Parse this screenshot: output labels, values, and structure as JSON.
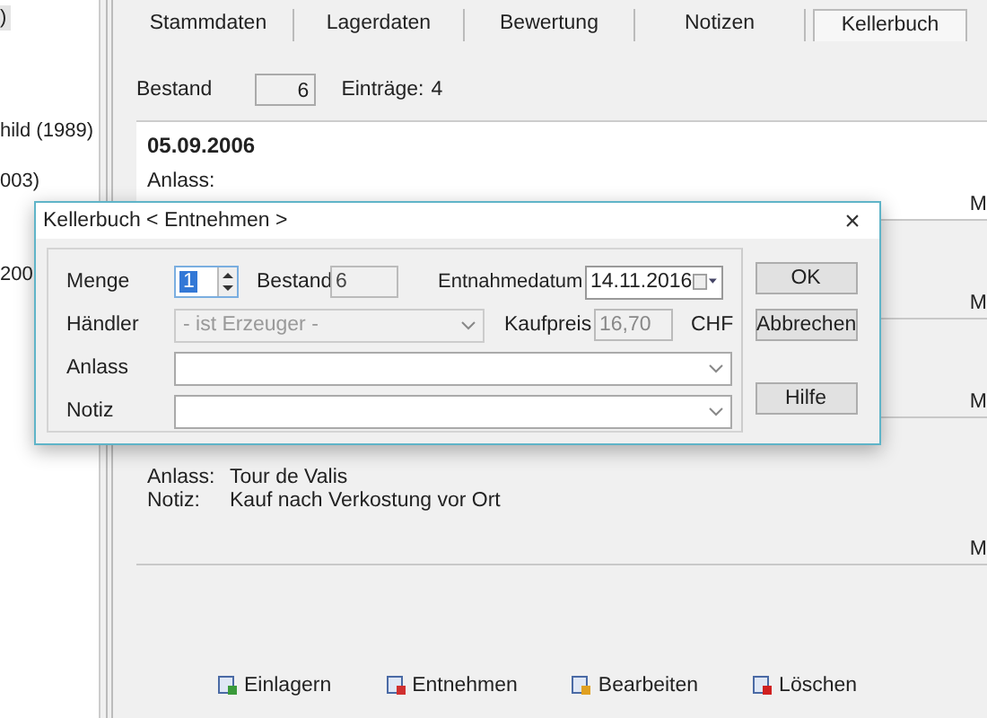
{
  "sidebar": {
    "items": [
      {
        "label": ")",
        "selected": true
      },
      {
        "label": "hild (1989)",
        "selected": false
      },
      {
        "label": "003)",
        "selected": false
      },
      {
        "label": "200",
        "selected": false
      }
    ]
  },
  "tabs": [
    {
      "label": "Stammdaten",
      "selected": false
    },
    {
      "label": "Lagerdaten",
      "selected": false
    },
    {
      "label": "Bewertung",
      "selected": false
    },
    {
      "label": "Notizen",
      "selected": false
    },
    {
      "label": "Kellerbuch",
      "selected": true
    }
  ],
  "summary": {
    "stock_label": "Bestand",
    "stock_value": "6",
    "entries_label": "Einträge:",
    "entries_count": "4"
  },
  "entries": [
    {
      "date": "05.09.2006",
      "occasion_label": "Anlass:",
      "column_3": "M",
      "selected": true
    },
    {
      "column_3": "M",
      "selected": false
    },
    {
      "column_3": "M",
      "selected": false
    },
    {
      "occasion_label": "Anlass:",
      "occasion": "Tour de Valis",
      "note_label": "Notiz:",
      "note": "Kauf nach Verkostung vor Ort",
      "column_3": "M",
      "selected": false
    }
  ],
  "actions": [
    "Einlagern",
    "Entnehmen",
    "Bearbeiten",
    "Löschen"
  ],
  "dialog": {
    "title": "Kellerbuch < Entnehmen >",
    "close": "×",
    "quantity_label": "Menge",
    "quantity": "1",
    "stock_label": "Bestand",
    "stock": "6",
    "date_label": "Entnahmedatum",
    "date": "14.11.2016",
    "dealer_label": "Händler",
    "dealer": "- ist Erzeuger -",
    "dealer_disabled": true,
    "price_label": "Kaufpreis",
    "price": "16,70",
    "currency": "CHF",
    "occasion_label": "Anlass",
    "note_label": "Notiz",
    "buttons": [
      "OK",
      "Abbrechen",
      "Hilfe"
    ]
  }
}
